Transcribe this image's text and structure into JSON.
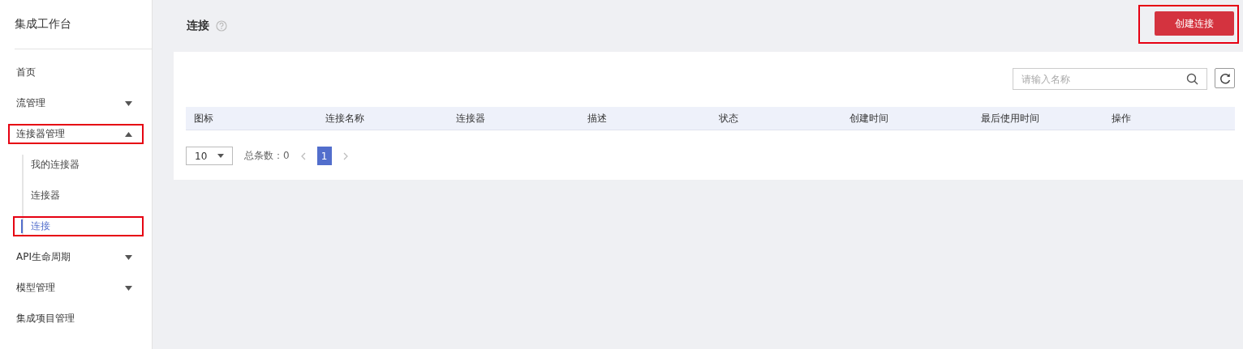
{
  "sidebar": {
    "title": "集成工作台",
    "items": [
      {
        "label": "首页",
        "selected": false,
        "highlighted": false
      },
      {
        "label": "流管理",
        "selected": false,
        "highlighted": false,
        "expanded": false
      },
      {
        "label": "连接器管理",
        "selected": false,
        "highlighted": true,
        "expanded": true,
        "children": [
          {
            "label": "我的连接器",
            "selected": false,
            "highlighted": false
          },
          {
            "label": "连接器",
            "selected": false,
            "highlighted": false
          },
          {
            "label": "连接",
            "selected": true,
            "highlighted": true
          }
        ]
      },
      {
        "label": "API生命周期",
        "selected": false,
        "highlighted": false,
        "expanded": false
      },
      {
        "label": "模型管理",
        "selected": false,
        "highlighted": false,
        "expanded": false
      },
      {
        "label": "集成项目管理",
        "selected": false,
        "highlighted": false
      }
    ]
  },
  "page": {
    "title": "连接",
    "create_button": {
      "label": "创建连接",
      "highlighted": true
    }
  },
  "search": {
    "placeholder": "请输入名称"
  },
  "table": {
    "columns": [
      "图标",
      "连接名称",
      "连接器",
      "描述",
      "状态",
      "创建时间",
      "最后使用时间",
      "操作"
    ]
  },
  "pagination": {
    "page_size": "10",
    "total": "总条数：0",
    "pages": [
      {
        "label": "1",
        "selected": true
      }
    ]
  }
}
